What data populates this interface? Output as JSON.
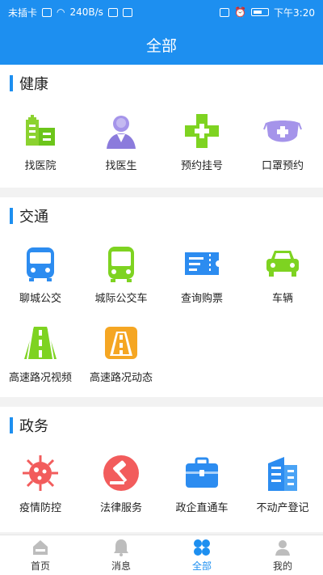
{
  "status_bar": {
    "carrier": "未插卡",
    "speed": "240B/s",
    "time": "下午3:20"
  },
  "header": {
    "title": "全部"
  },
  "sections": [
    {
      "title": "健康",
      "items": [
        {
          "label": "找医院",
          "icon": "hospital-icon"
        },
        {
          "label": "找医生",
          "icon": "doctor-icon"
        },
        {
          "label": "预约挂号",
          "icon": "appointment-cross-icon"
        },
        {
          "label": "口罩预约",
          "icon": "mask-icon"
        }
      ]
    },
    {
      "title": "交通",
      "items": [
        {
          "label": "聊城公交",
          "icon": "bus-icon"
        },
        {
          "label": "城际公交车",
          "icon": "intercity-bus-icon"
        },
        {
          "label": "查询购票",
          "icon": "ticket-icon"
        },
        {
          "label": "车辆",
          "icon": "car-icon"
        },
        {
          "label": "高速路况视频",
          "icon": "highway-video-icon"
        },
        {
          "label": "高速路况动态",
          "icon": "highway-status-icon"
        }
      ]
    },
    {
      "title": "政务",
      "items": [
        {
          "label": "疫情防控",
          "icon": "virus-icon"
        },
        {
          "label": "法律服务",
          "icon": "gavel-icon"
        },
        {
          "label": "政企直通车",
          "icon": "briefcase-icon"
        },
        {
          "label": "不动产登记",
          "icon": "building-icon"
        }
      ]
    }
  ],
  "tabbar": [
    {
      "label": "首页",
      "icon": "home-icon",
      "active": false
    },
    {
      "label": "消息",
      "icon": "bell-icon",
      "active": false
    },
    {
      "label": "全部",
      "icon": "grid-icon",
      "active": true
    },
    {
      "label": "我的",
      "icon": "user-icon",
      "active": false
    }
  ],
  "colors": {
    "primary": "#1d8ff0",
    "green": "#7ed321",
    "purple": "#8b7bdc",
    "orange": "#f5a623",
    "red": "#f25c5c",
    "inactive_tab": "#bdbdbd"
  }
}
